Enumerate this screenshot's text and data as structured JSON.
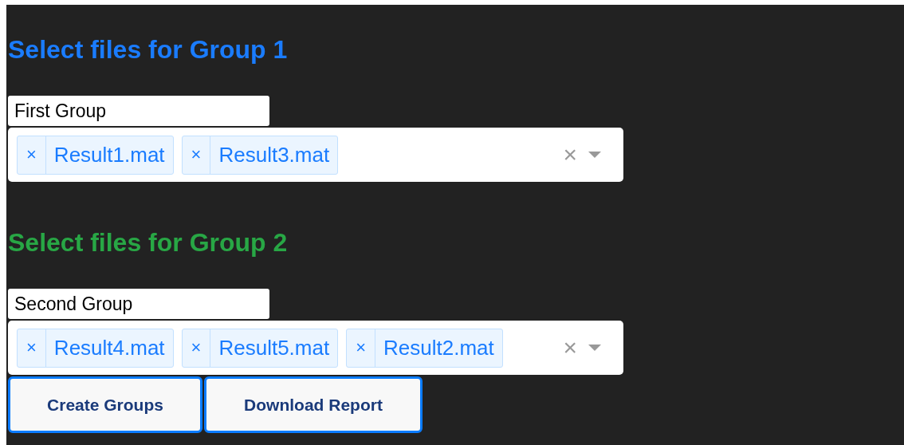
{
  "groups": [
    {
      "heading": "Select files for Group 1",
      "color": "#1a7cff",
      "name_value": "First Group",
      "files": [
        {
          "remove": "×",
          "label": "Result1.mat"
        },
        {
          "remove": "×",
          "label": "Result3.mat"
        }
      ],
      "clear": "×"
    },
    {
      "heading": "Select files for Group 2",
      "color": "#28a745",
      "name_value": "Second Group",
      "files": [
        {
          "remove": "×",
          "label": "Result4.mat"
        },
        {
          "remove": "×",
          "label": "Result5.mat"
        },
        {
          "remove": "×",
          "label": "Result2.mat"
        }
      ],
      "clear": "×"
    }
  ],
  "buttons": [
    "Create Groups",
    "Download Report"
  ]
}
